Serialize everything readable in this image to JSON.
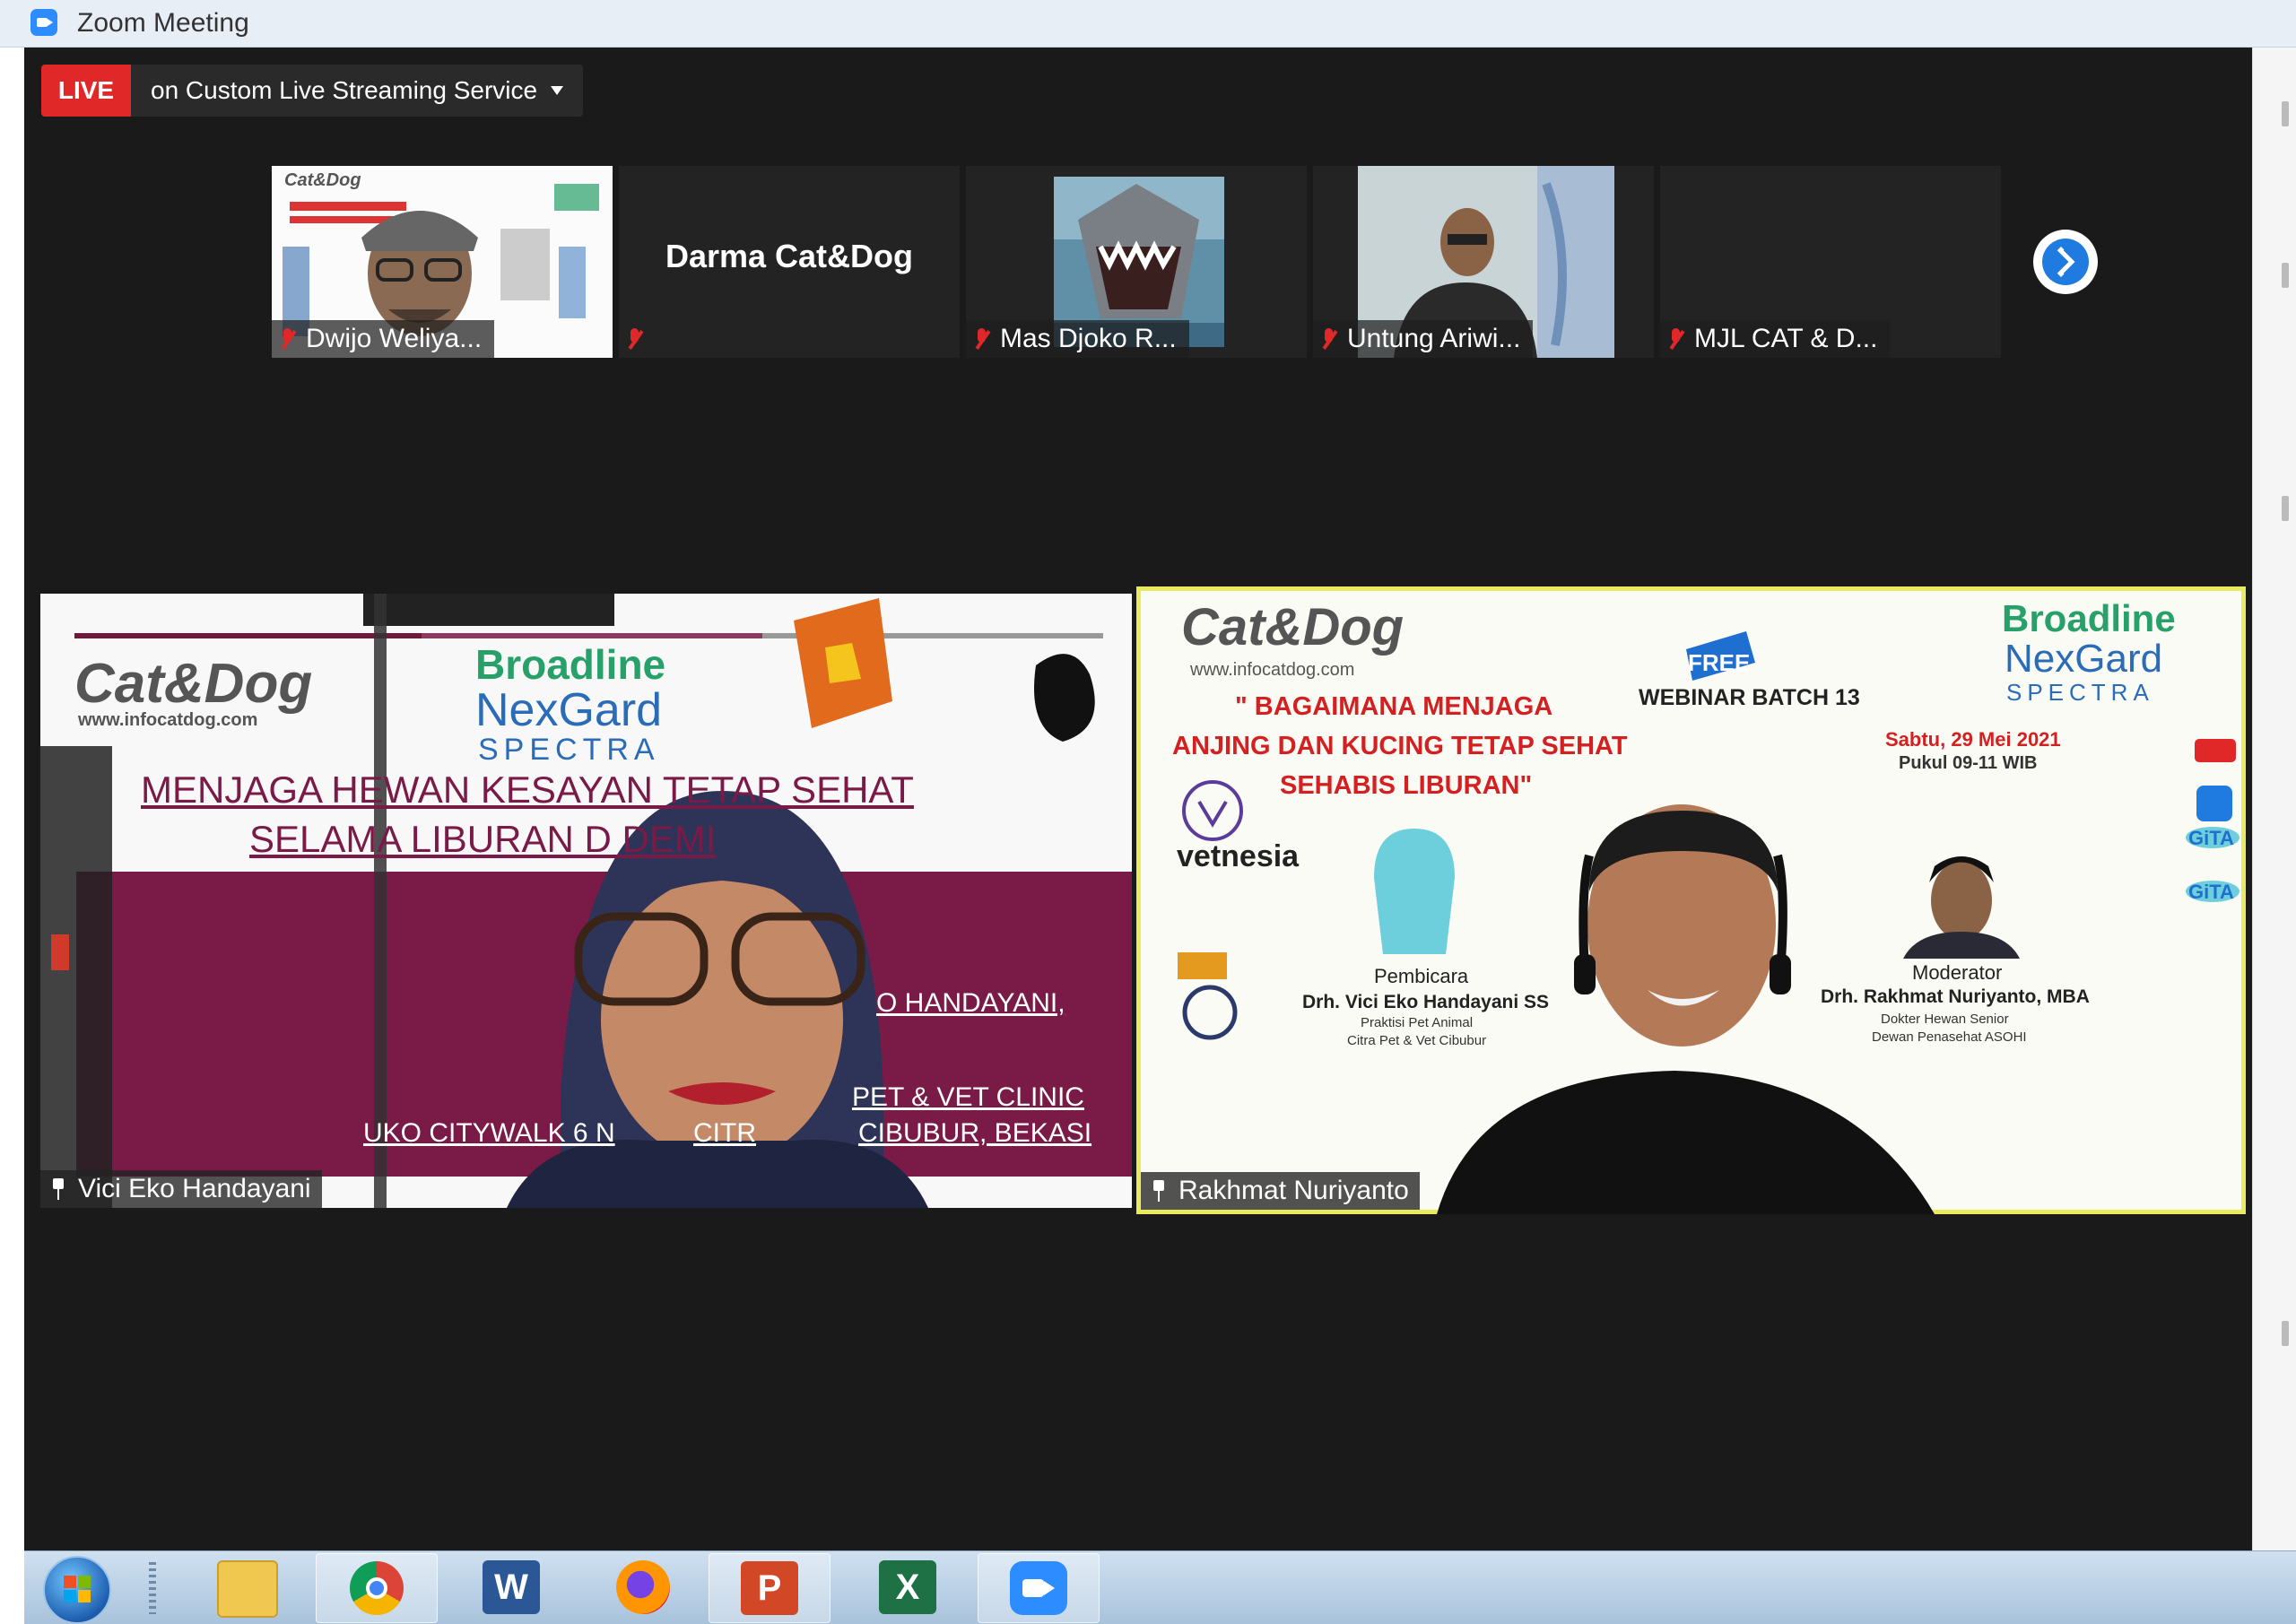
{
  "window": {
    "title": "Zoom Meeting"
  },
  "live": {
    "badge": "LIVE",
    "stream_label": "on Custom Live Streaming Service"
  },
  "thumbnails": [
    {
      "name": "Dwijo Weliya...",
      "video": true
    },
    {
      "name": "",
      "display_name": "Darma Cat&Dog",
      "video": false
    },
    {
      "name": "Mas Djoko R...",
      "video": true
    },
    {
      "name": "Untung Ariwi...",
      "video": true
    },
    {
      "name": "MJL CAT & D...",
      "video": false
    }
  ],
  "speakers": [
    {
      "name": "Vici Eko Handayani",
      "slide": {
        "logo": "Cat&Dog",
        "url": "www.infocatdog.com",
        "brand1": "Broadline",
        "brand2": "NexGard",
        "brand3": "SPECTRA",
        "line1": "MENJAGA HEWAN KESAYAN     TETAP SEHAT",
        "line2": "SELAMA LIBURAN D         DEMI",
        "l3": "O HANDAYANI,",
        "l4": "PET & VET CLINIC",
        "l5a": "UKO CITYWALK 6 N",
        "l5b": "CITR",
        "l5c": "CIBUBUR, BEKASI"
      }
    },
    {
      "name": "Rakhmat Nuriyanto",
      "slide": {
        "logo": "Cat&Dog",
        "url": "www.infocatdog.com",
        "free": "FREE",
        "webinar": "WEBINAR BATCH 13",
        "title1": "\" BAGAIMANA MENJAGA",
        "title2": "ANJING DAN KUCING TETAP SEHAT",
        "title3": "SEHABIS LIBURAN\"",
        "date": "Sabtu, 29 Mei 2021",
        "time": "Pukul 09-11 WIB",
        "vetnesia": "vetnesia",
        "pembicara": "Pembicara",
        "speaker_name": "Drh. Vici Eko Handayani SS",
        "speaker_role1": "Praktisi Pet Animal",
        "speaker_role2": "Citra Pet & Vet Cibubur",
        "moderator": "Moderator",
        "moderator_name": "Drh. Rakhmat Nuriyanto, MBA",
        "moderator_role1": "Dokter Hewan Senior",
        "moderator_role2": "Dewan Penasehat ASOHI",
        "brand1": "Broadline",
        "brand2": "NexGard",
        "brand3": "SPECTRA",
        "gita": "GiTA"
      }
    }
  ],
  "taskbar": {
    "items": [
      "file-explorer-icon",
      "chrome-icon",
      "word-icon",
      "firefox-icon",
      "powerpoint-icon",
      "excel-icon",
      "zoom-icon"
    ]
  },
  "colors": {
    "live": "#e02828",
    "meeting_bg": "#1a1a1a",
    "active_speaker_border": "#e8ea60",
    "slide_maroon": "#7a1a47"
  }
}
